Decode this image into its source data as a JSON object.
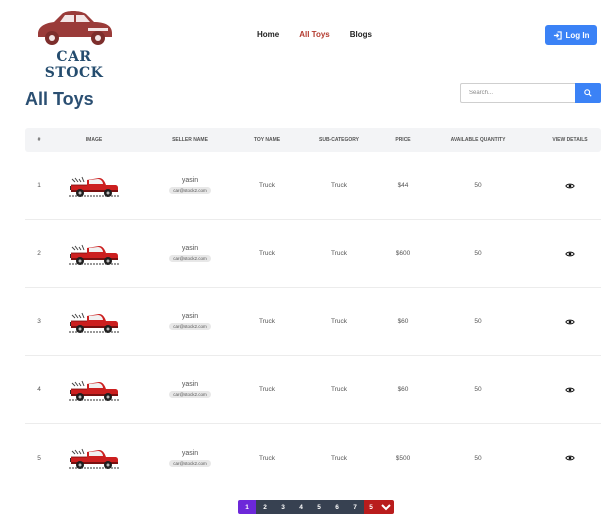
{
  "brand": {
    "name": "CAR STOCK"
  },
  "nav": {
    "items": [
      {
        "label": "Home"
      },
      {
        "label": "All Toys"
      },
      {
        "label": "Blogs"
      }
    ],
    "login_label": "Log In"
  },
  "page": {
    "title": "All Toys"
  },
  "search": {
    "placeholder": "Search..."
  },
  "table": {
    "headers": [
      "#",
      "IMAGE",
      "SELLER NAME",
      "TOY NAME",
      "SUB-CATEGORY",
      "PRICE",
      "AVAILABLE QUANTITY",
      "VIEW DETAILS"
    ],
    "rows": [
      {
        "index": "1",
        "seller": "yasin",
        "email": "car@stock2.com",
        "toy": "Truck",
        "sub": "Truck",
        "price": "$44",
        "qty": "50"
      },
      {
        "index": "2",
        "seller": "yasin",
        "email": "car@stock2.com",
        "toy": "Truck",
        "sub": "Truck",
        "price": "$600",
        "qty": "50"
      },
      {
        "index": "3",
        "seller": "yasin",
        "email": "car@stock2.com",
        "toy": "Truck",
        "sub": "Truck",
        "price": "$60",
        "qty": "50"
      },
      {
        "index": "4",
        "seller": "yasin",
        "email": "car@stock2.com",
        "toy": "Truck",
        "sub": "Truck",
        "price": "$60",
        "qty": "50"
      },
      {
        "index": "5",
        "seller": "yasin",
        "email": "car@stock2.com",
        "toy": "Truck",
        "sub": "Truck",
        "price": "$500",
        "qty": "50"
      }
    ]
  },
  "pagination": {
    "pages": [
      "1",
      "2",
      "3",
      "4",
      "5",
      "6",
      "7",
      "5"
    ],
    "active": "1"
  },
  "colors": {
    "accent": "#3b82f6",
    "title": "#2b4f72",
    "active_nav": "#b33a2e",
    "truck": "#cc1f1f",
    "page_active": "#6d28d9",
    "page_last": "#b91c1c"
  },
  "icons": {
    "logo": "vintage-car-logo",
    "login": "login-icon",
    "search": "search-icon",
    "view": "eye-icon",
    "truck": "truck-image",
    "dropdown": "chevron-down-icon"
  }
}
